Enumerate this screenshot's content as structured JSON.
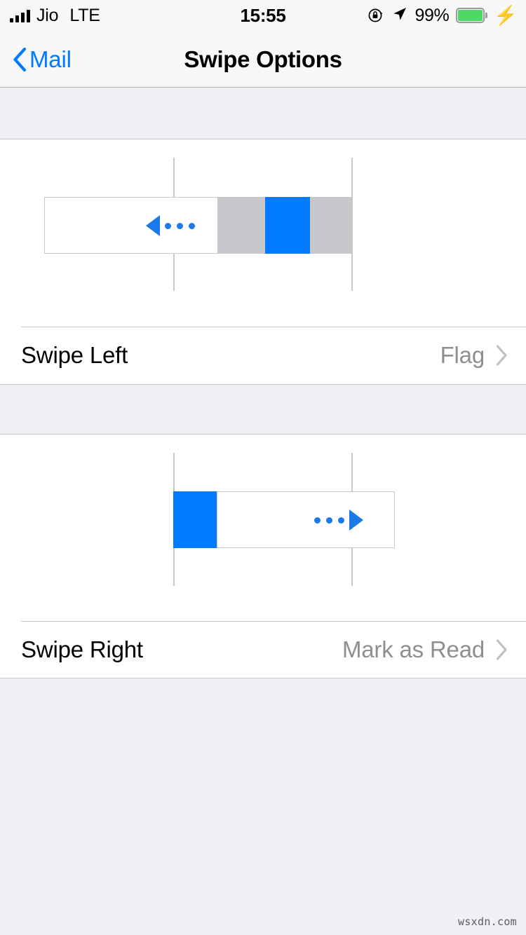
{
  "status_bar": {
    "carrier": "Jio",
    "network": "LTE",
    "time": "15:55",
    "battery_percent": "99%",
    "icons": {
      "signal": "signal-bars-icon",
      "rotation_lock": "rotation-lock-icon",
      "location": "location-arrow-icon",
      "battery": "battery-icon",
      "charging": "lightning-bolt-icon"
    },
    "battery_color": "#4CD964"
  },
  "nav_bar": {
    "back_label": "Mail",
    "title": "Swipe Options",
    "tint": "#007AFF"
  },
  "sections": [
    {
      "illustration": {
        "name": "swipe-left-illustration",
        "direction": "left",
        "arrow_order": "triangle-then-dots"
      },
      "row": {
        "label": "Swipe Left",
        "value": "Flag"
      }
    },
    {
      "illustration": {
        "name": "swipe-right-illustration",
        "direction": "right",
        "arrow_order": "dots-then-triangle"
      },
      "row": {
        "label": "Swipe Right",
        "value": "Mark as Read"
      }
    }
  ],
  "colors": {
    "accent_blue": "#007AFF",
    "arrow_blue": "#1A7BE8",
    "action_gray": "#C7C7CC",
    "group_background": "#EFEFF4",
    "separator": "#C8C7CC",
    "value_text": "#8E8E93"
  },
  "watermark": "wsxdn.com"
}
